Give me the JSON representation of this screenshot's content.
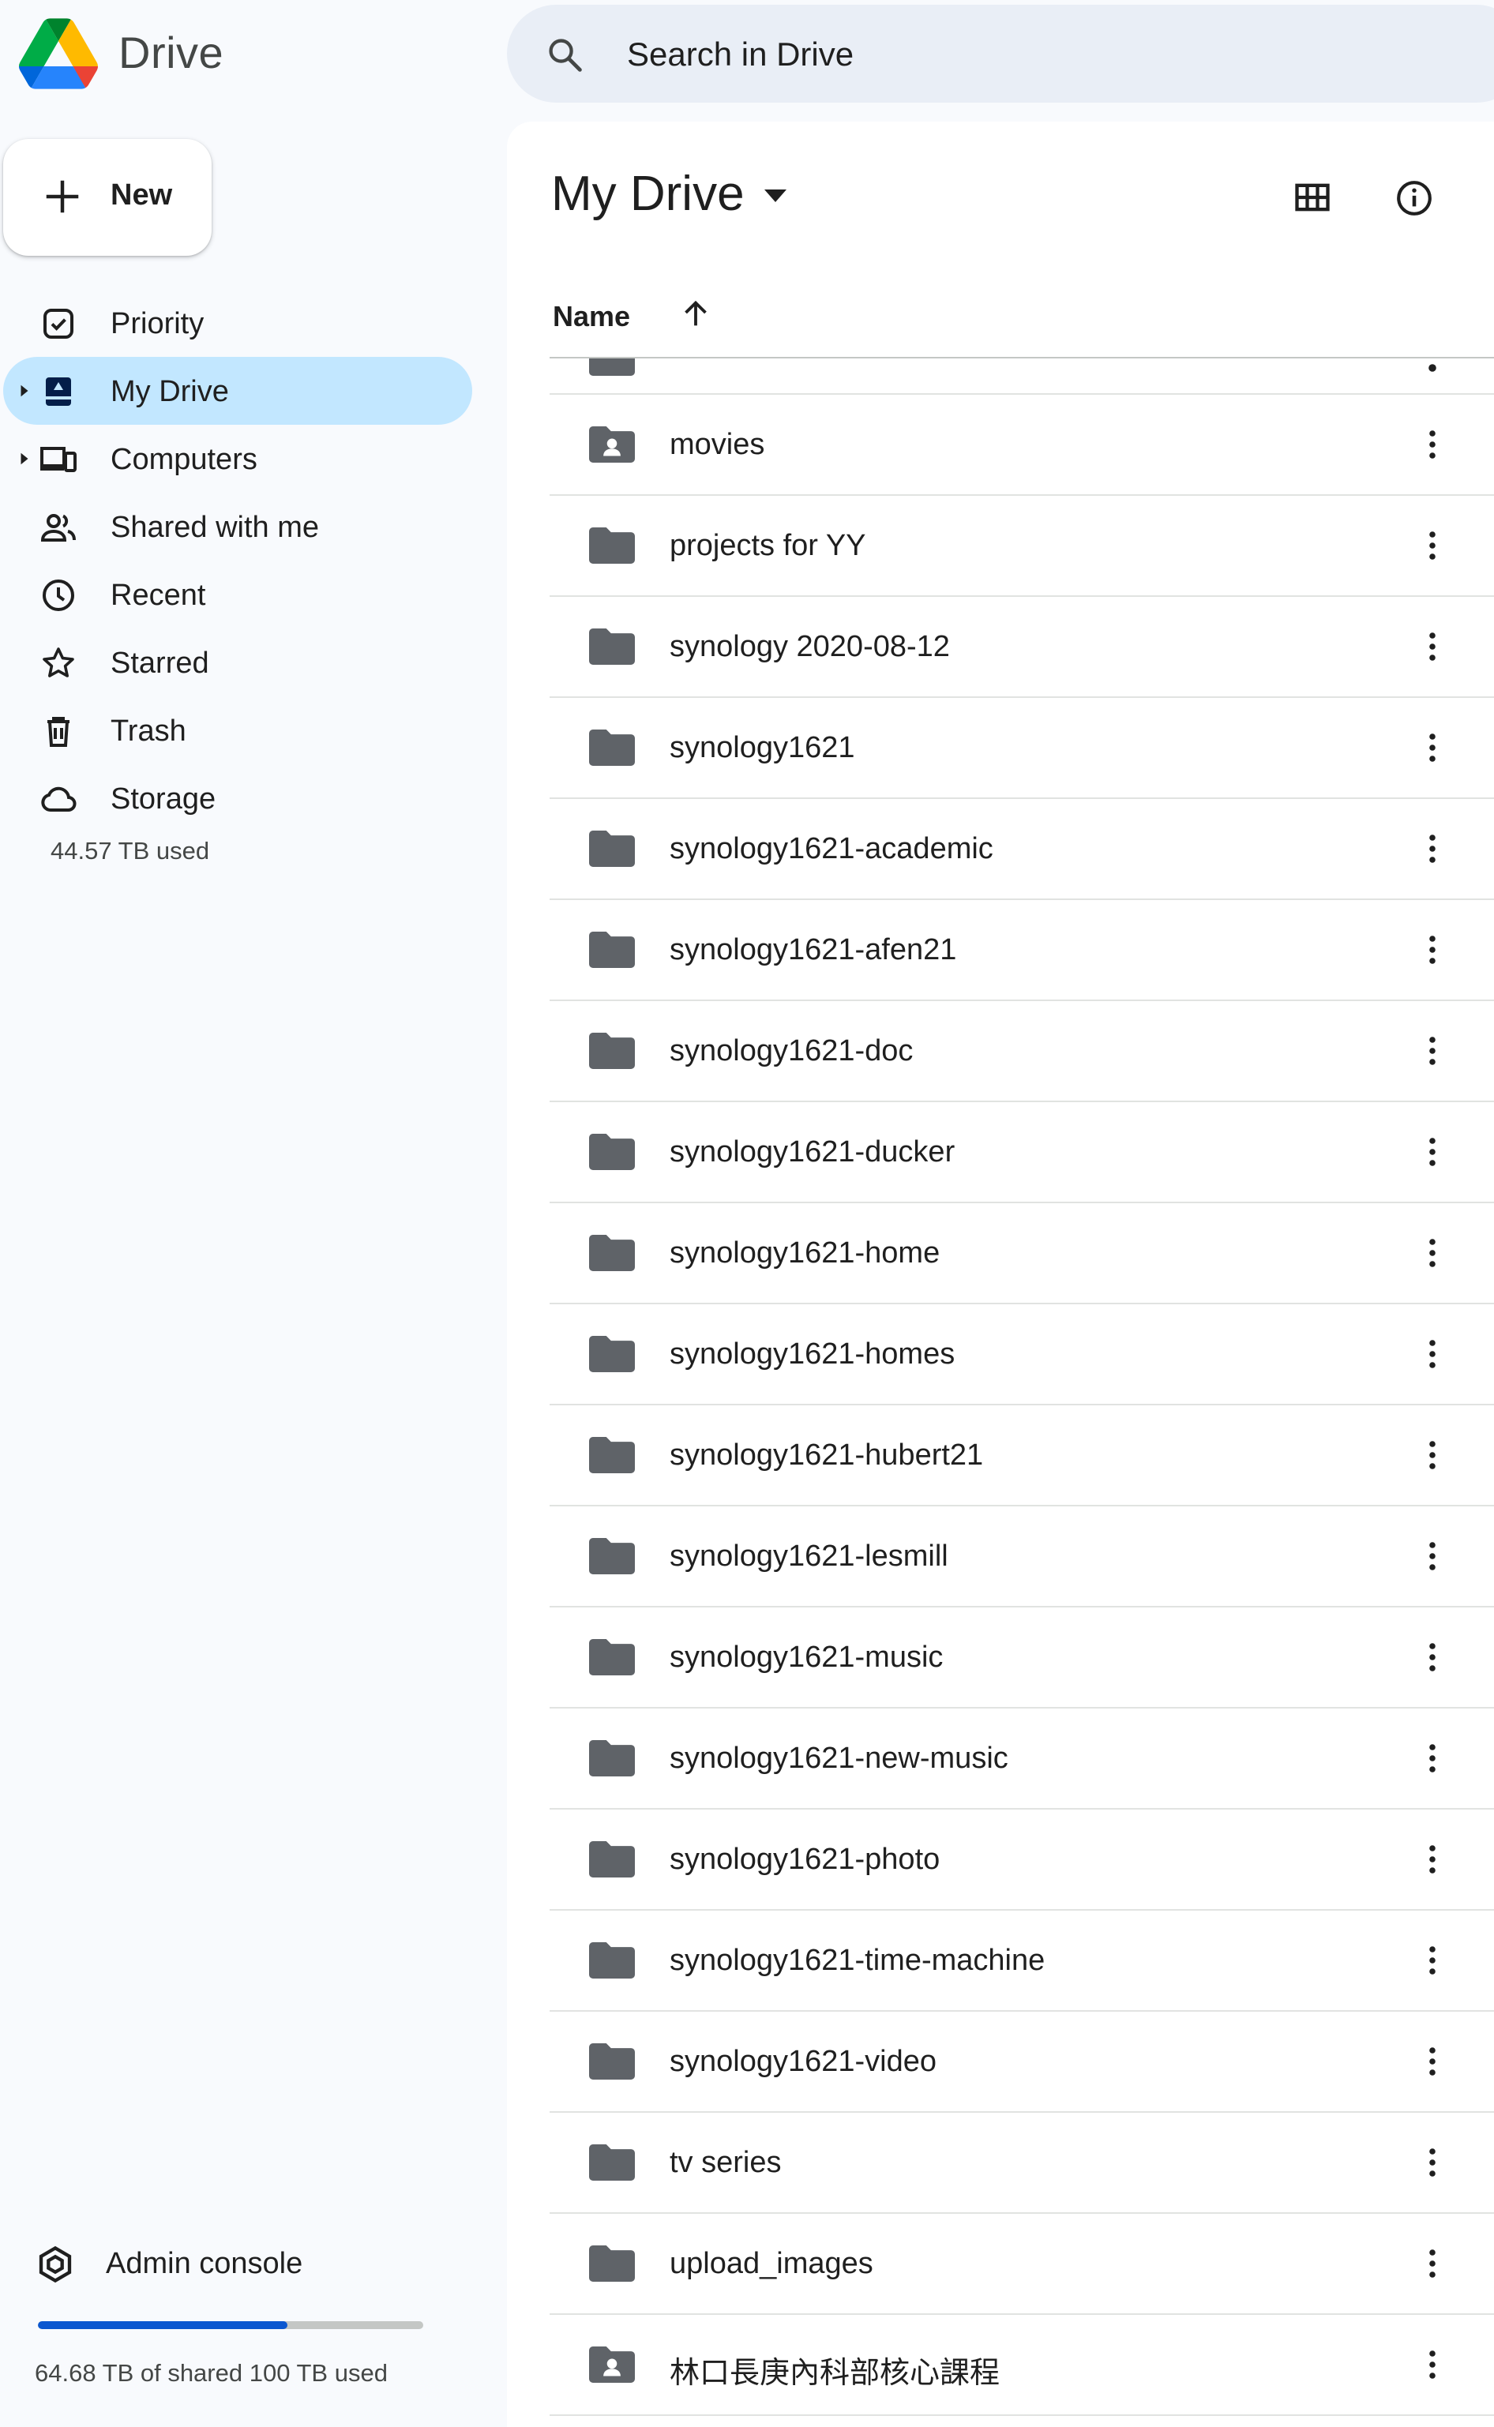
{
  "app": {
    "title": "Drive"
  },
  "search": {
    "placeholder": "Search in Drive"
  },
  "new_button": {
    "label": "New"
  },
  "sidebar": {
    "items": [
      {
        "label": "Priority",
        "icon": "priority-icon",
        "active": false,
        "expandable": false
      },
      {
        "label": "My Drive",
        "icon": "my-drive-icon",
        "active": true,
        "expandable": true
      },
      {
        "label": "Computers",
        "icon": "computers-icon",
        "active": false,
        "expandable": true
      },
      {
        "label": "Shared with me",
        "icon": "shared-icon",
        "active": false,
        "expandable": false
      },
      {
        "label": "Recent",
        "icon": "clock-icon",
        "active": false,
        "expandable": false
      },
      {
        "label": "Starred",
        "icon": "star-icon",
        "active": false,
        "expandable": false
      },
      {
        "label": "Trash",
        "icon": "trash-icon",
        "active": false,
        "expandable": false
      },
      {
        "label": "Storage",
        "icon": "cloud-icon",
        "active": false,
        "expandable": false
      }
    ],
    "storage_used": "44.57 TB used",
    "admin_console": "Admin console",
    "shared_quota": {
      "text": "64.68 TB of shared 100 TB used",
      "fraction": 0.6468
    }
  },
  "main": {
    "title": "My Drive",
    "column_header": "Name",
    "sort": "ascending",
    "files": [
      {
        "name": "movies",
        "type": "shared-folder"
      },
      {
        "name": "projects for YY",
        "type": "folder"
      },
      {
        "name": "synology 2020-08-12",
        "type": "folder"
      },
      {
        "name": "synology1621",
        "type": "folder"
      },
      {
        "name": "synology1621-academic",
        "type": "folder"
      },
      {
        "name": "synology1621-afen21",
        "type": "folder"
      },
      {
        "name": "synology1621-doc",
        "type": "folder"
      },
      {
        "name": "synology1621-ducker",
        "type": "folder"
      },
      {
        "name": "synology1621-home",
        "type": "folder"
      },
      {
        "name": "synology1621-homes",
        "type": "folder"
      },
      {
        "name": "synology1621-hubert21",
        "type": "folder"
      },
      {
        "name": "synology1621-lesmill",
        "type": "folder"
      },
      {
        "name": "synology1621-music",
        "type": "folder"
      },
      {
        "name": "synology1621-new-music",
        "type": "folder"
      },
      {
        "name": "synology1621-photo",
        "type": "folder"
      },
      {
        "name": "synology1621-time-machine",
        "type": "folder"
      },
      {
        "name": "synology1621-video",
        "type": "folder"
      },
      {
        "name": "tv series",
        "type": "folder"
      },
      {
        "name": "upload_images",
        "type": "folder"
      },
      {
        "name": "林口長庚內科部核心課程",
        "type": "shared-folder"
      }
    ]
  },
  "colors": {
    "background": "#f8fafd",
    "search_bg": "#e9eef6",
    "active_nav": "#c2e7ff",
    "accent_blue": "#0b57d0",
    "icon_gray": "#5f6368",
    "text": "#1f1f1f"
  }
}
